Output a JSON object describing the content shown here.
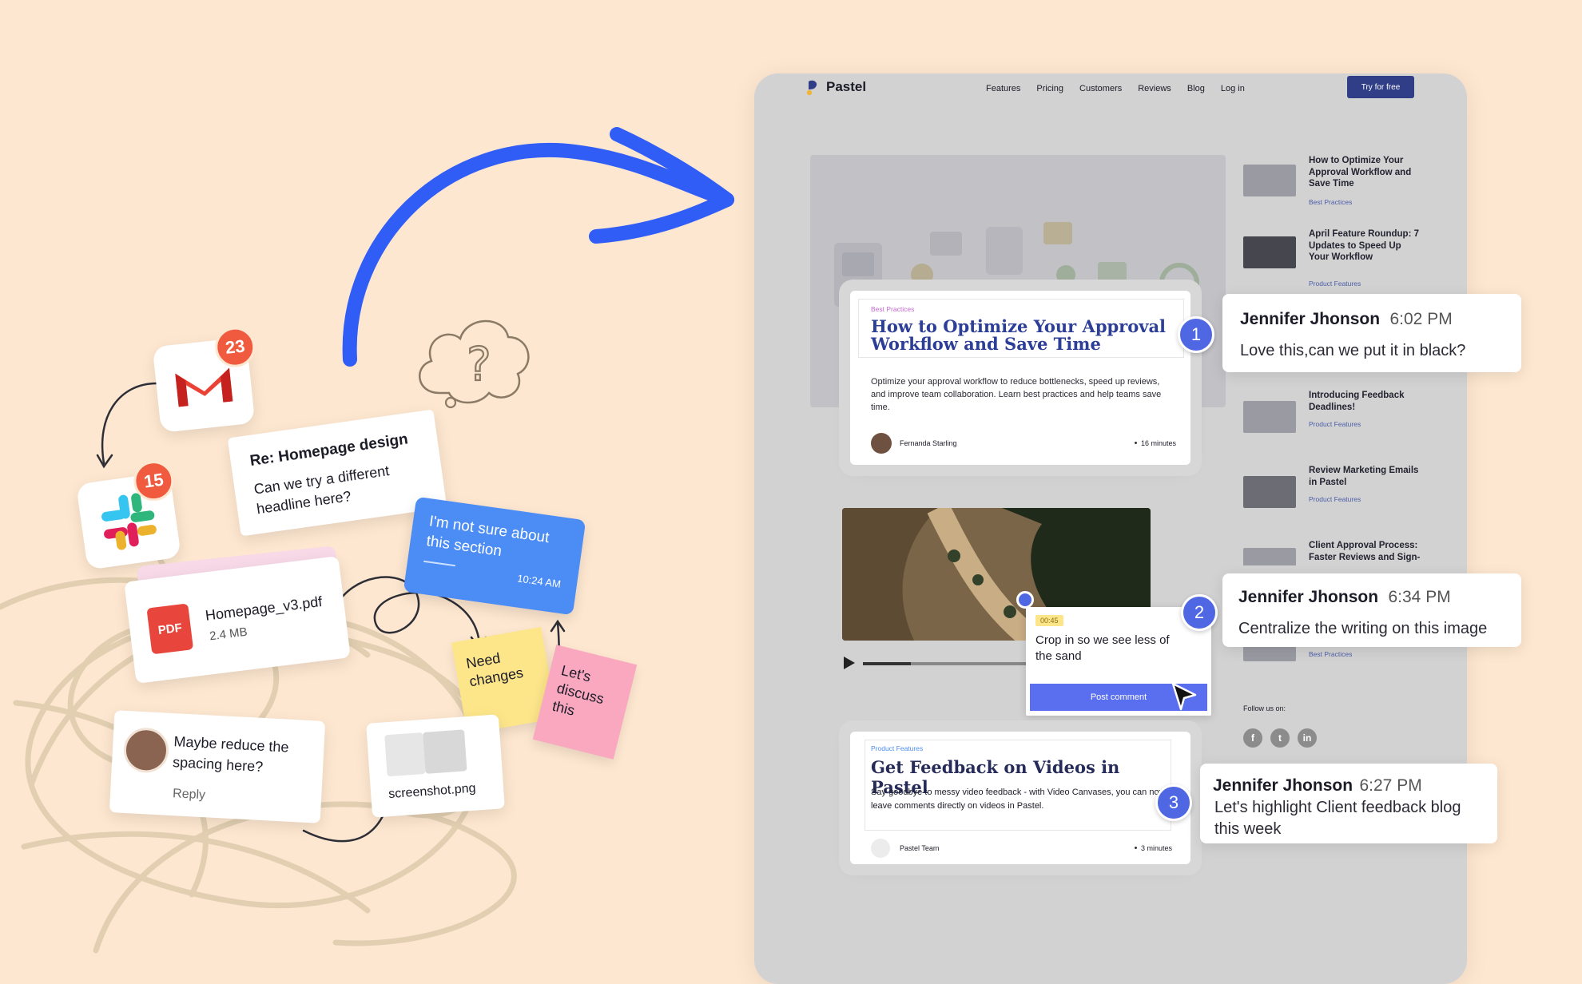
{
  "colors": {
    "background": "#fde7d0",
    "accent": "#2f5df6",
    "nav_button": "#2f3e86",
    "pin": "#5067e3",
    "post_button": "#5a6ff0",
    "badge": "#f05a3e"
  },
  "collage": {
    "gmail": {
      "icon": "gmail-icon",
      "badge": "23"
    },
    "slack": {
      "icon": "slack-icon",
      "badge": "15"
    },
    "email_card": {
      "subject": "Re: Homepage design",
      "body": "Can we try a different headline here?"
    },
    "chat_bubble": {
      "text": "I'm not sure about this section",
      "time": "10:24 AM"
    },
    "pdf_card": {
      "icon_label": "PDF",
      "filename": "Homepage_v3.pdf",
      "size": "2.4 MB"
    },
    "sticky_yellow": "Need changes",
    "sticky_pink": "Let's discuss this",
    "reply_card": {
      "text": "Maybe reduce the spacing here?",
      "reply": "Reply"
    },
    "screenshot_card": {
      "filename": "screenshot.png"
    }
  },
  "browser": {
    "logo": "Pastel",
    "nav": [
      "Features",
      "Pricing",
      "Customers",
      "Reviews",
      "Blog",
      "Log in"
    ],
    "cta": "Try for free",
    "featured": {
      "tag": "Best Practices",
      "title": "How to Optimize Your Approval Workflow and Save Time",
      "excerpt": "Optimize your approval workflow to reduce bottlenecks, speed up reviews, and improve team collaboration. Learn best practices and help teams save time.",
      "author": "Fernanda Starling",
      "read_time": "16 minutes"
    },
    "video": {
      "timestamp": "00:45",
      "comment": "Crop in so we see less of the sand",
      "post_button": "Post comment"
    },
    "second_article": {
      "tag": "Product Features",
      "title": "Get Feedback on Videos in Pastel",
      "excerpt": "Say goodbye to messy video feedback - with Video Canvases, you can now leave comments directly on videos in Pastel.",
      "author": "Pastel Team",
      "read_time": "3 minutes"
    },
    "sidebar": [
      {
        "title": "How to Optimize Your Approval Workflow and Save Time",
        "tag": "Best Practices"
      },
      {
        "title": "April Feature Roundup: 7 Updates to Speed Up Your Workflow",
        "tag": "Product Features"
      },
      {
        "title": "Introducing Feedback Deadlines!",
        "tag": "Product Features"
      },
      {
        "title": "Review Marketing Emails in Pastel",
        "tag": "Product Features"
      },
      {
        "title": "Client Approval Process: Faster Reviews and Sign-",
        "tag": ""
      },
      {
        "title": "",
        "tag": "Best Practices"
      }
    ],
    "follow": "Follow us on:",
    "social": [
      "f",
      "t",
      "in"
    ]
  },
  "comments": [
    {
      "pin": "1",
      "name": "Jennifer Jhonson",
      "time": "6:02 PM",
      "text": "Love this,can we put it in black?"
    },
    {
      "pin": "2",
      "name": "Jennifer Jhonson",
      "time": "6:34 PM",
      "text": "Centralize the writing on this image"
    },
    {
      "pin": "3",
      "name": "Jennifer Jhonson",
      "time": "6:27 PM",
      "text": "Let's highlight Client feedback blog this week"
    }
  ]
}
